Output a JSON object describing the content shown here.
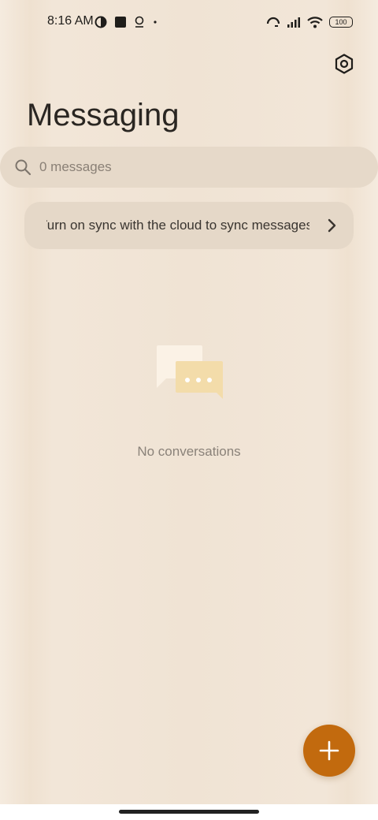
{
  "status_bar": {
    "time": "8:16 AM",
    "battery": "100",
    "left_icons": [
      "data-saver-icon",
      "square-notification-icon",
      "location-pin-icon",
      "dot-icon"
    ],
    "right_icons": [
      "hotspot-icon",
      "signal-icon",
      "wifi-icon",
      "battery-icon"
    ]
  },
  "header": {
    "title": "Messaging",
    "settings_icon": "settings-hexagon-icon"
  },
  "search": {
    "placeholder": "0 messages"
  },
  "sync_banner": {
    "text": "Turn on sync with the cloud to sync messages"
  },
  "empty_state": {
    "icon": "chat-bubbles-icon",
    "text": "No conversations"
  },
  "fab": {
    "icon": "plus-icon"
  },
  "colors": {
    "background": "#f1e5d7",
    "accent": "#c26a0e",
    "search_bg": "#e6d9c9"
  }
}
